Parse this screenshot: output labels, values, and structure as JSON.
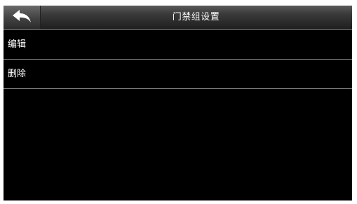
{
  "header": {
    "title": "门禁组设置",
    "back_icon": "back-arrow-icon"
  },
  "menu": {
    "items": [
      {
        "label": "编辑"
      },
      {
        "label": "删除"
      }
    ]
  },
  "colors": {
    "background": "#000000",
    "text": "#ffffff",
    "divider": "#8a8a8a",
    "header_top": "#5a5a5a",
    "header_bottom": "#1e1e1e"
  }
}
